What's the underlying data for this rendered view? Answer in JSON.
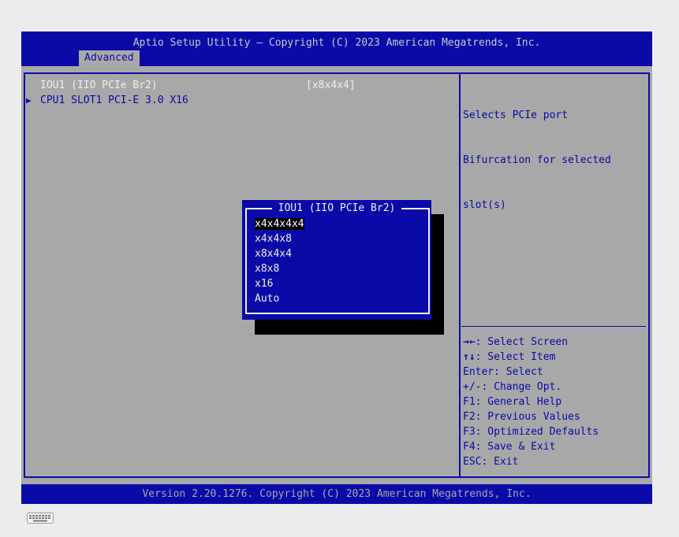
{
  "header": {
    "title": "Aptio Setup Utility – Copyright (C) 2023 American Megatrends, Inc.",
    "active_tab": "Advanced"
  },
  "main": {
    "setting": {
      "label": "IOU1 (IIO PCIe Br2)",
      "value": "[x8x4x4]"
    },
    "submenu": {
      "arrow": "▶",
      "label": "CPU1 SLOT1 PCI-E 3.0 X16"
    }
  },
  "help": {
    "lines": [
      "Selects PCIe port",
      "Bifurcation for selected",
      "slot(s)"
    ]
  },
  "keys": [
    {
      "key": "→←",
      "text": ": Select Screen"
    },
    {
      "key": "↑↓",
      "text": ": Select Item"
    },
    {
      "key": "Enter",
      "text": ": Select"
    },
    {
      "key": "+/-",
      "text": ": Change Opt."
    },
    {
      "key": "F1",
      "text": ": General Help"
    },
    {
      "key": "F2",
      "text": ": Previous Values"
    },
    {
      "key": "F3",
      "text": ": Optimized Defaults"
    },
    {
      "key": "F4",
      "text": ": Save & Exit"
    },
    {
      "key": "ESC",
      "text": ": Exit"
    }
  ],
  "popup": {
    "title": "IOU1 (IIO PCIe Br2)",
    "options": [
      "x4x4x4x4",
      "x4x4x8",
      "x8x4x4",
      "x8x8",
      "x16",
      "Auto"
    ],
    "selected": "x4x4x4x4"
  },
  "footer": {
    "text": "Version 2.20.1276. Copyright (C) 2023 American Megatrends, Inc."
  },
  "colors": {
    "bios_blue": "#0a0aa8",
    "panel_gray": "#a8a8a8",
    "text_white": "#eeeeee",
    "shadow": "#000000"
  },
  "icons": {
    "submenu": "triangle-right-icon",
    "taskbar": "keyboard-icon"
  }
}
